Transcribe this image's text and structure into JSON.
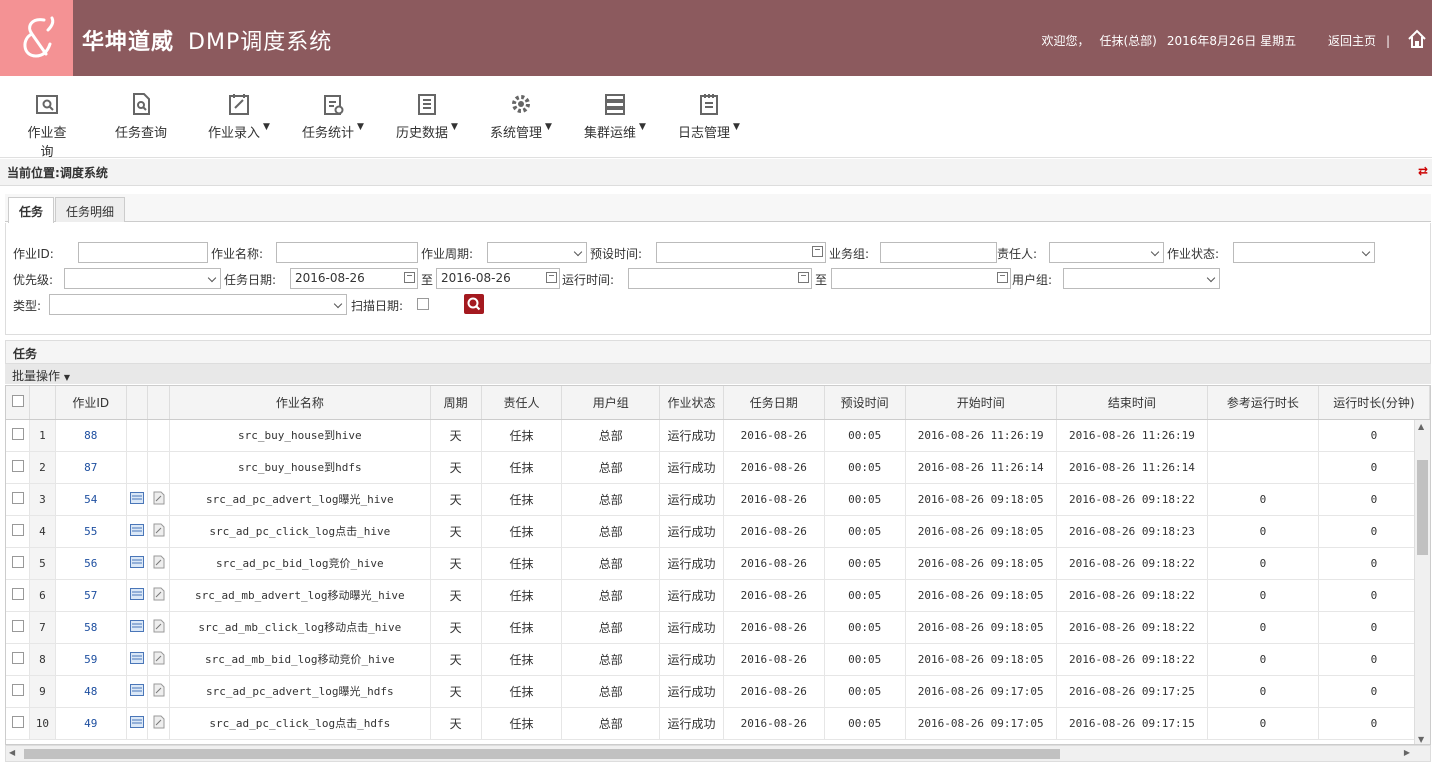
{
  "header": {
    "brand": "华坤道威",
    "system": "DMP调度系统",
    "welcome": "欢迎您，",
    "user": "任抹(总部)",
    "date": "2016年8月26日 星期五",
    "home_link": "返回主页",
    "separator": "|"
  },
  "toolbar": [
    {
      "label": "作业查询",
      "icon": "job-search-icon",
      "dropdown": false
    },
    {
      "label": "任务查询",
      "icon": "task-search-icon",
      "dropdown": false
    },
    {
      "label": "作业录入",
      "icon": "job-entry-icon",
      "dropdown": true
    },
    {
      "label": "任务统计",
      "icon": "task-stats-icon",
      "dropdown": true
    },
    {
      "label": "历史数据",
      "icon": "history-icon",
      "dropdown": true
    },
    {
      "label": "系统管理",
      "icon": "gear-icon",
      "dropdown": true
    },
    {
      "label": "集群运维",
      "icon": "server-icon",
      "dropdown": true
    },
    {
      "label": "日志管理",
      "icon": "log-icon",
      "dropdown": true
    }
  ],
  "breadcrumb": {
    "label": "当前位置:",
    "value": "调度系统"
  },
  "tabs": [
    "任务",
    "任务明细"
  ],
  "filters": {
    "job_id": "作业ID:",
    "job_name": "作业名称:",
    "job_cycle": "作业周期:",
    "preset_time": "预设时间:",
    "biz_group": "业务组:",
    "owner": "责任人:",
    "job_status": "作业状态:",
    "priority": "优先级:",
    "task_date": "任务日期:",
    "task_date_from": "2016-08-26",
    "to1": "至",
    "task_date_to": "2016-08-26",
    "run_time": "运行时间:",
    "to2": "至",
    "user_group": "用户组:",
    "type": "类型:",
    "scan_date": "扫描日期:"
  },
  "panel": {
    "title": "任务",
    "batch": "批量操作"
  },
  "table": {
    "headers": [
      "作业ID",
      "",
      "",
      "作业名称",
      "周期",
      "责任人",
      "用户组",
      "作业状态",
      "任务日期",
      "预设时间",
      "开始时间",
      "结束时间",
      "参考运行时长",
      "运行时长(分钟)"
    ],
    "rows": [
      {
        "n": "1",
        "id": "88",
        "icons": false,
        "name": "src_buy_house到hive",
        "cycle": "天",
        "owner": "任抹",
        "group": "总部",
        "status": "运行成功",
        "date": "2016-08-26",
        "preset": "00:05",
        "start": "2016-08-26 11:26:19",
        "end": "2016-08-26 11:26:19",
        "ref": "",
        "dur": "0"
      },
      {
        "n": "2",
        "id": "87",
        "icons": false,
        "name": "src_buy_house到hdfs",
        "cycle": "天",
        "owner": "任抹",
        "group": "总部",
        "status": "运行成功",
        "date": "2016-08-26",
        "preset": "00:05",
        "start": "2016-08-26 11:26:14",
        "end": "2016-08-26 11:26:14",
        "ref": "",
        "dur": "0"
      },
      {
        "n": "3",
        "id": "54",
        "icons": true,
        "name": "src_ad_pc_advert_log曝光_hive",
        "cycle": "天",
        "owner": "任抹",
        "group": "总部",
        "status": "运行成功",
        "date": "2016-08-26",
        "preset": "00:05",
        "start": "2016-08-26 09:18:05",
        "end": "2016-08-26 09:18:22",
        "ref": "0",
        "dur": "0"
      },
      {
        "n": "4",
        "id": "55",
        "icons": true,
        "name": "src_ad_pc_click_log点击_hive",
        "cycle": "天",
        "owner": "任抹",
        "group": "总部",
        "status": "运行成功",
        "date": "2016-08-26",
        "preset": "00:05",
        "start": "2016-08-26 09:18:05",
        "end": "2016-08-26 09:18:23",
        "ref": "0",
        "dur": "0"
      },
      {
        "n": "5",
        "id": "56",
        "icons": true,
        "name": "src_ad_pc_bid_log竞价_hive",
        "cycle": "天",
        "owner": "任抹",
        "group": "总部",
        "status": "运行成功",
        "date": "2016-08-26",
        "preset": "00:05",
        "start": "2016-08-26 09:18:05",
        "end": "2016-08-26 09:18:22",
        "ref": "0",
        "dur": "0"
      },
      {
        "n": "6",
        "id": "57",
        "icons": true,
        "name": "src_ad_mb_advert_log移动曝光_hive",
        "cycle": "天",
        "owner": "任抹",
        "group": "总部",
        "status": "运行成功",
        "date": "2016-08-26",
        "preset": "00:05",
        "start": "2016-08-26 09:18:05",
        "end": "2016-08-26 09:18:22",
        "ref": "0",
        "dur": "0"
      },
      {
        "n": "7",
        "id": "58",
        "icons": true,
        "name": "src_ad_mb_click_log移动点击_hive",
        "cycle": "天",
        "owner": "任抹",
        "group": "总部",
        "status": "运行成功",
        "date": "2016-08-26",
        "preset": "00:05",
        "start": "2016-08-26 09:18:05",
        "end": "2016-08-26 09:18:22",
        "ref": "0",
        "dur": "0"
      },
      {
        "n": "8",
        "id": "59",
        "icons": true,
        "name": "src_ad_mb_bid_log移动竞价_hive",
        "cycle": "天",
        "owner": "任抹",
        "group": "总部",
        "status": "运行成功",
        "date": "2016-08-26",
        "preset": "00:05",
        "start": "2016-08-26 09:18:05",
        "end": "2016-08-26 09:18:22",
        "ref": "0",
        "dur": "0"
      },
      {
        "n": "9",
        "id": "48",
        "icons": true,
        "name": "src_ad_pc_advert_log曝光_hdfs",
        "cycle": "天",
        "owner": "任抹",
        "group": "总部",
        "status": "运行成功",
        "date": "2016-08-26",
        "preset": "00:05",
        "start": "2016-08-26 09:17:05",
        "end": "2016-08-26 09:17:25",
        "ref": "0",
        "dur": "0"
      },
      {
        "n": "10",
        "id": "49",
        "icons": true,
        "name": "src_ad_pc_click_log点击_hdfs",
        "cycle": "天",
        "owner": "任抹",
        "group": "总部",
        "status": "运行成功",
        "date": "2016-08-26",
        "preset": "00:05",
        "start": "2016-08-26 09:17:05",
        "end": "2016-08-26 09:17:15",
        "ref": "0",
        "dur": "0"
      }
    ]
  },
  "colors": {
    "header": "#8c5a5e",
    "logo": "#f49294",
    "accent": "#a4191f",
    "link": "#1e4fa0"
  }
}
